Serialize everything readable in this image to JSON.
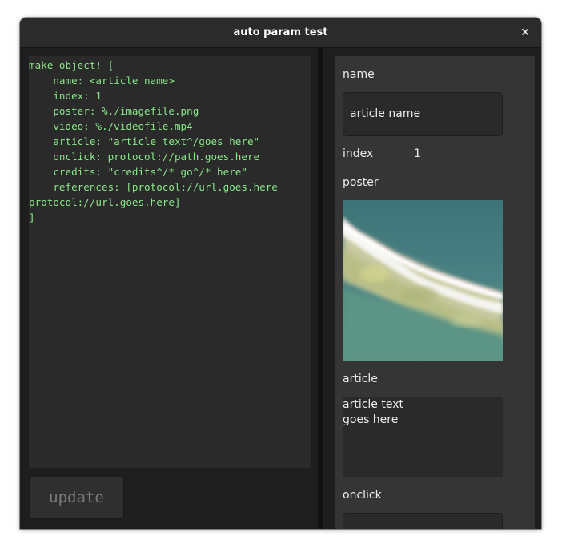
{
  "window": {
    "title": "auto param test",
    "close_glyph": "✕"
  },
  "editor": {
    "code": "make object! [\n    name: <article name>\n    index: 1\n    poster: %./imagefile.png\n    video: %./videofile.mp4\n    article: \"article text^/goes here\"\n    onclick: protocol://path.goes.here\n    credits: \"credits^/* go^/* here\"\n    references: [protocol://url.goes.here\nprotocol://url.goes.here]\n]",
    "update_label": "update"
  },
  "form": {
    "name_label": "name",
    "name_value": "article name",
    "index_label": "index",
    "index_value": "1",
    "poster_label": "poster",
    "poster_icon": "poster-image",
    "article_label": "article",
    "article_value": "article text\ngoes here",
    "onclick_label": "onclick"
  },
  "colors": {
    "window_bg": "#1e1e1e",
    "titlebar_bg": "#2b2b2b",
    "code_text": "#8ae68a",
    "form_bg": "#353535"
  }
}
